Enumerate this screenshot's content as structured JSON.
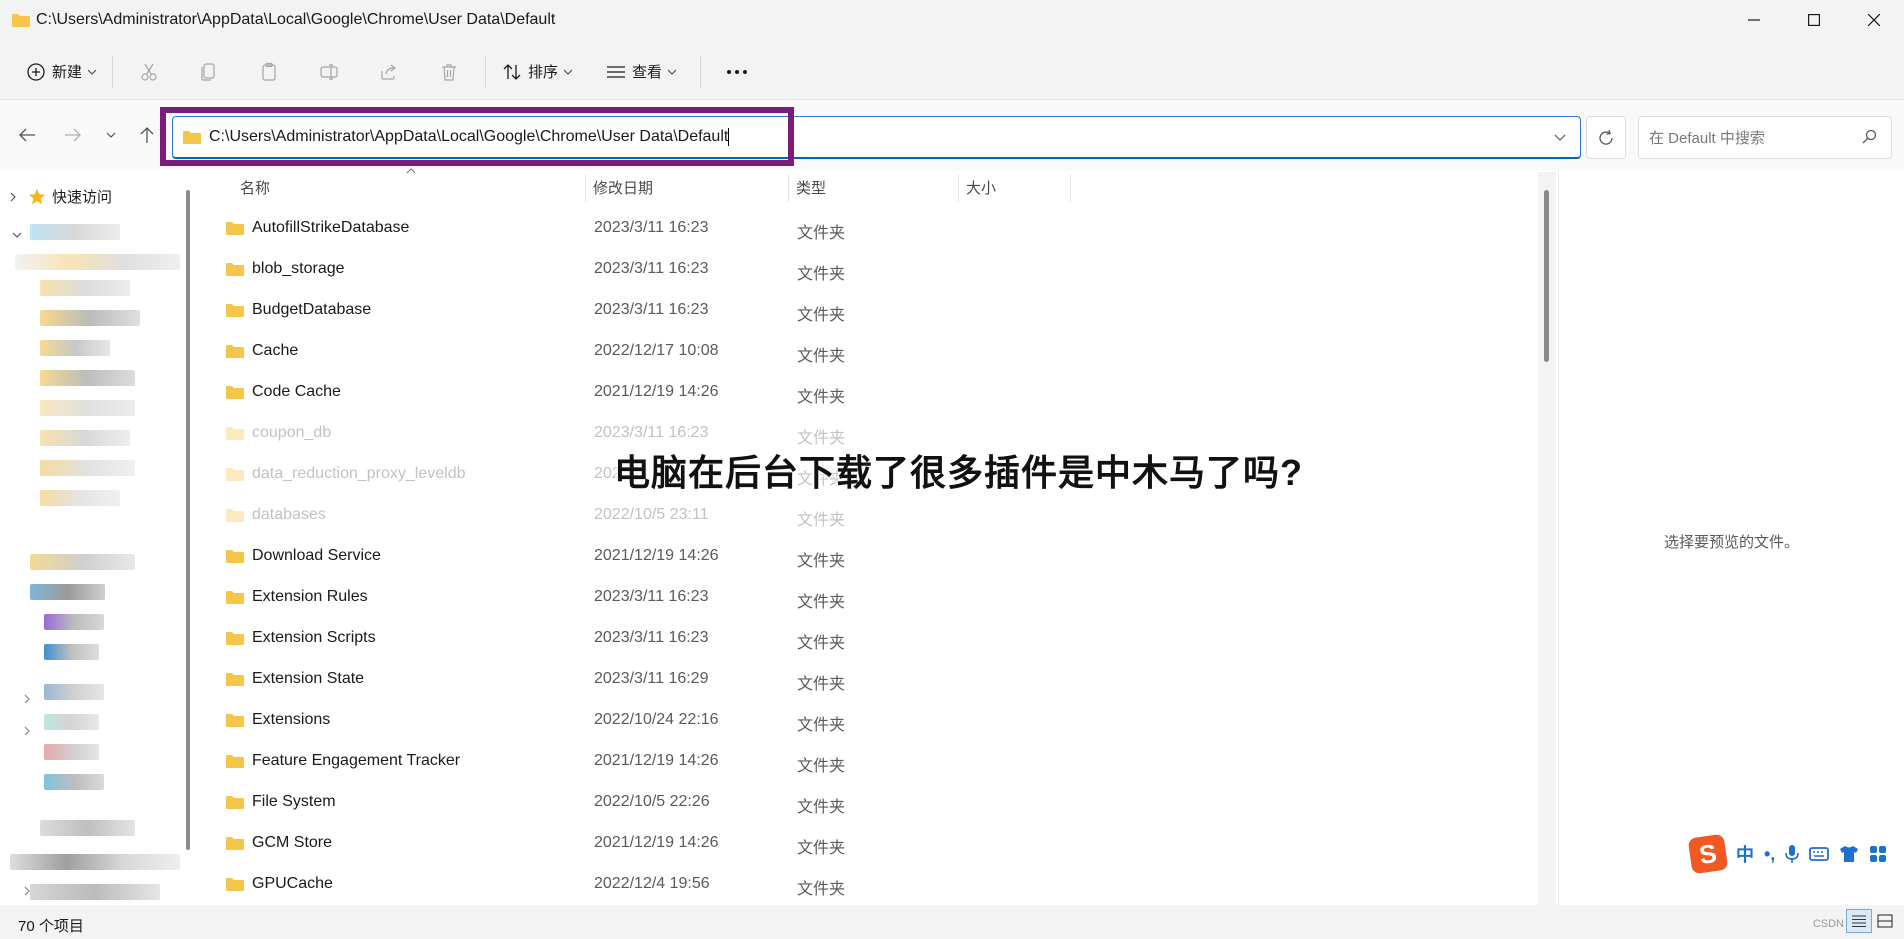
{
  "window": {
    "title": "C:\\Users\\Administrator\\AppData\\Local\\Google\\Chrome\\User Data\\Default"
  },
  "toolbar": {
    "new_label": "新建",
    "sort_label": "排序",
    "view_label": "查看"
  },
  "address": {
    "path": "C:\\Users\\Administrator\\AppData\\Local\\Google\\Chrome\\User Data\\Default"
  },
  "search": {
    "placeholder": "在 Default 中搜索"
  },
  "sidebar": {
    "quick_access_label": "快速访问"
  },
  "columns": {
    "name": "名称",
    "date": "修改日期",
    "type": "类型",
    "size": "大小"
  },
  "files": [
    {
      "name": "AutofillStrikeDatabase",
      "date": "2023/3/11 16:23",
      "type": "文件夹"
    },
    {
      "name": "blob_storage",
      "date": "2023/3/11 16:23",
      "type": "文件夹"
    },
    {
      "name": "BudgetDatabase",
      "date": "2023/3/11 16:23",
      "type": "文件夹"
    },
    {
      "name": "Cache",
      "date": "2022/12/17 10:08",
      "type": "文件夹"
    },
    {
      "name": "Code Cache",
      "date": "2021/12/19 14:26",
      "type": "文件夹"
    },
    {
      "name": "coupon_db",
      "date": "2023/3/11 16:23",
      "type": "文件夹"
    },
    {
      "name": "data_reduction_proxy_leveldb",
      "date": "202",
      "type": "文件夹"
    },
    {
      "name": "databases",
      "date": "2022/10/5 23:11",
      "type": "文件夹"
    },
    {
      "name": "Download Service",
      "date": "2021/12/19 14:26",
      "type": "文件夹"
    },
    {
      "name": "Extension Rules",
      "date": "2023/3/11 16:23",
      "type": "文件夹"
    },
    {
      "name": "Extension Scripts",
      "date": "2023/3/11 16:23",
      "type": "文件夹"
    },
    {
      "name": "Extension State",
      "date": "2023/3/11 16:29",
      "type": "文件夹"
    },
    {
      "name": "Extensions",
      "date": "2022/10/24 22:16",
      "type": "文件夹"
    },
    {
      "name": "Feature Engagement Tracker",
      "date": "2021/12/19 14:26",
      "type": "文件夹"
    },
    {
      "name": "File System",
      "date": "2022/10/5 22:26",
      "type": "文件夹"
    },
    {
      "name": "GCM Store",
      "date": "2021/12/19 14:26",
      "type": "文件夹"
    },
    {
      "name": "GPUCache",
      "date": "2022/12/4 19:56",
      "type": "文件夹"
    }
  ],
  "preview": {
    "message": "选择要预览的文件。"
  },
  "overlay": {
    "headline": "电脑在后台下载了很多插件是中木马了吗?"
  },
  "status": {
    "item_count": "70 个项目"
  },
  "watermark": {
    "text": "CSDN"
  },
  "ime": {
    "logo": "S",
    "lang": "中",
    "punct": "•,"
  },
  "colors": {
    "highlight_box": "#7a1d7a",
    "folder": "#f4c64a",
    "accent": "#0067c0"
  }
}
